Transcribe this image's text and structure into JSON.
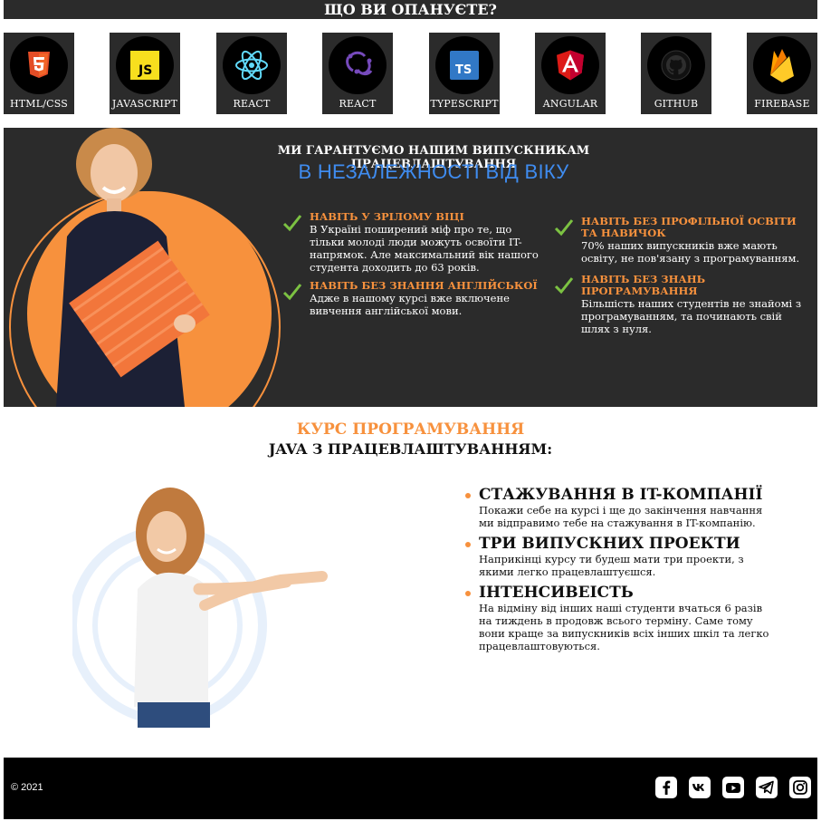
{
  "top": {
    "heading": "ЩО ВИ ОПАНУЄТЕ?"
  },
  "tech": [
    {
      "label": "HTML/CSS",
      "icon": "html5-icon",
      "color": "#e44d26"
    },
    {
      "label": "JAVASCRIPT",
      "icon": "javascript-icon",
      "color": "#f7df1e"
    },
    {
      "label": "REACT",
      "icon": "react-icon",
      "color": "#61dafb"
    },
    {
      "label": "REACT",
      "icon": "redux-icon",
      "color": "#764abc"
    },
    {
      "label": "TYPESCRIPT",
      "icon": "typescript-icon",
      "color": "#3178c6"
    },
    {
      "label": "ANGULAR",
      "icon": "angular-icon",
      "color": "#dd1b16"
    },
    {
      "label": "GITHUB",
      "icon": "github-icon",
      "color": "#ffffff"
    },
    {
      "label": "FIREBASE",
      "icon": "firebase-icon",
      "color": "#ffca28"
    }
  ],
  "banner": {
    "title": "МИ ГАРАНТУЄМО НАШИМ ВИПУСКНИКАМ ПРАЦЕВЛАШТУВАННЯ",
    "subtitle": "В НЕЗАЛЕЖНОСТІ ВІД ВІКУ",
    "features": [
      {
        "title": "НАВІТЬ У ЗРІЛОМУ ВІЦІ",
        "text": "В Україні поширений міф про те, що тільки молоді люди можуть освоїти IT-напрямок. Але максимальний вік нашого студента доходить до 63 років."
      },
      {
        "title": "НАВІТЬ БЕЗ ЗНАННЯ АНГЛІЙСЬКОЇ",
        "text": "Адже в нашому курсі вже включене вивчення англійської мови."
      },
      {
        "title": "НАВІТЬ БЕЗ ПРОФІЛЬНОЇ ОСВІТИ ТА НАВИЧОК",
        "text": "70% наших випускників вже мають освіту, не пов'язану з програмуванням."
      },
      {
        "title": "НАВІТЬ БЕЗ ЗНАНЬ ПРОГРАМУВАННЯ",
        "text": "Більшість наших студентів не знайомі з програмуванням, та починають свій шлях з нуля."
      }
    ]
  },
  "course": {
    "heading": "КУРС ПРОГРАМУВАННЯ",
    "subheading": "JAVA З ПРАЦЕВЛАШТУВАННЯМ:",
    "benefits": [
      {
        "title": "СТАЖУВАННЯ В IT-КОМПАНІЇ",
        "text": "Покажи себе на курсі і ще до закінчення навчання ми відправимо тебе на стажування в IT-компанію."
      },
      {
        "title": "ТРИ ВИПУСКНИХ ПРОЕКТИ",
        "text": "Наприкінці курсу ти будеш мати три проекти, з якими легко працевлаштуєшся."
      },
      {
        "title": "ІНТЕНСИВЕІСТЬ",
        "text": "На відміну від інших наші студенти вчаться 6 разів на тиждень в продовж всього терміну. Саме тому вони краще за випускників всіх інших шкіл та легко працевлаштовуються."
      }
    ]
  },
  "footer": {
    "copyright": "© 2021",
    "social": [
      "facebook-icon",
      "vk-icon",
      "youtube-icon",
      "telegram-icon",
      "instagram-icon"
    ]
  },
  "colors": {
    "accent": "#f7913d",
    "blue": "#3f8cf0",
    "dark": "#2b2b2b"
  }
}
